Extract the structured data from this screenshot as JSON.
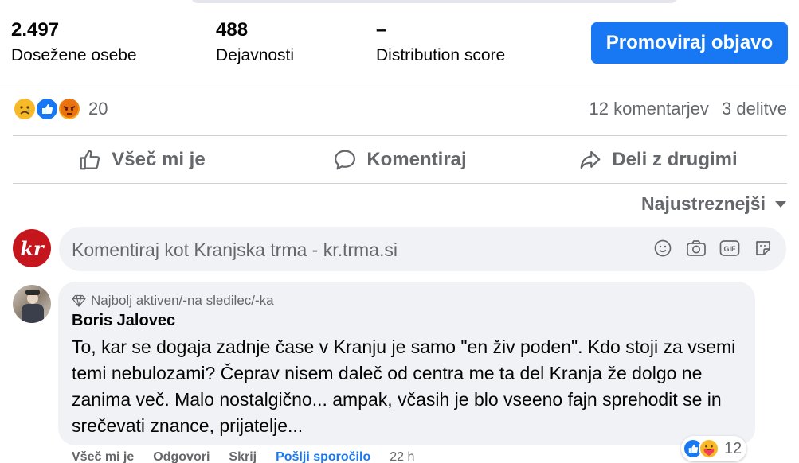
{
  "stats": {
    "reach_value": "2.497",
    "reach_label": "Dosežene osebe",
    "engagement_value": "488",
    "engagement_label": "Dejavnosti",
    "distribution_value": "–",
    "distribution_label": "Distribution score",
    "promote_label": "Promoviraj objavo"
  },
  "reactions": {
    "icons": [
      "sad-icon",
      "like-icon",
      "angry-icon"
    ],
    "count": "20",
    "comments": "12 komentarjev",
    "shares": "3 delitve"
  },
  "actions": {
    "like": "Všeč mi je",
    "comment": "Komentiraj",
    "share": "Deli z drugimi"
  },
  "sort": {
    "label": "Najustreznejši"
  },
  "composer": {
    "avatar_text": "kr",
    "placeholder": "Komentiraj kot Kranjska trma - kr.trma.si",
    "icons": [
      "emoji-icon",
      "camera-icon",
      "gif-icon",
      "sticker-icon"
    ]
  },
  "comment": {
    "badge": "Najbolj aktiven/-na sledilec/-ka",
    "author": "Boris Jalovec",
    "text": "To, kar se dogaja zadnje čase v Kranju je samo \"en živ poden\". Kdo stoji za vsemi temi nebulozami? Čeprav nisem daleč od centra me ta del Kranja že dolgo ne zanima več. Malo nostalgično... ampak, včasih je blo vseeno fajn sprehodit se in srečevati znance, prijatelje...",
    "reaction_icons": [
      "like-icon",
      "care-icon"
    ],
    "reaction_count": "12",
    "like": "Všeč mi je",
    "reply": "Odgovori",
    "hide": "Skrij",
    "send_message": "Pošlji sporočilo",
    "time": "22 h"
  },
  "colors": {
    "accent": "#1877f2",
    "muted_text": "#65676b",
    "bubble_bg": "#f0f2f5",
    "divider": "#ced0d4"
  }
}
